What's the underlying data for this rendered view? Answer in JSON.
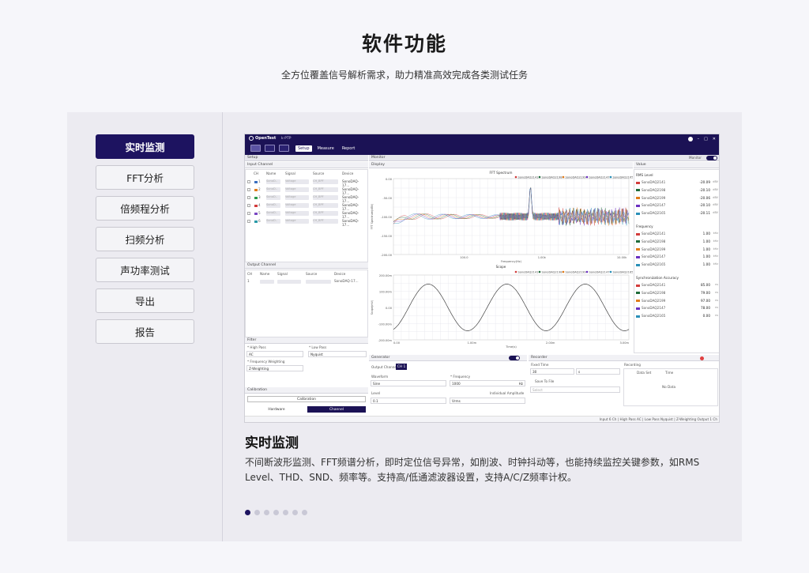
{
  "header": {
    "title": "软件功能",
    "subtitle": "全方位覆盖信号解析需求，助力精准高效完成各类测试任务"
  },
  "menu": {
    "items": [
      {
        "label": "实时监测",
        "active": true
      },
      {
        "label": "FFT分析",
        "active": false
      },
      {
        "label": "倍频程分析",
        "active": false
      },
      {
        "label": "扫频分析",
        "active": false
      },
      {
        "label": "声功率测试",
        "active": false
      },
      {
        "label": "导出",
        "active": false
      },
      {
        "label": "报告",
        "active": false
      }
    ]
  },
  "app": {
    "logo": "OpenTest",
    "project": "k-PTP",
    "tabs": [
      "Setup",
      "Measure",
      "Report"
    ],
    "setup_title": "Setup",
    "monitor_title": "Monitor",
    "monitor_label": "Monitor",
    "display_title": "Display",
    "value_title": "Value",
    "input_channel": {
      "title": "Input Channel",
      "columns": [
        "CH",
        "Name",
        "Signal",
        "Source",
        "Device"
      ],
      "rows": [
        {
          "ch": "1",
          "name": "SonoD..",
          "signal": "Voltage",
          "source": "CH_BPF",
          "device": "SonoDAQ-17..."
        },
        {
          "ch": "2",
          "name": "SonoD..",
          "signal": "Voltage",
          "source": "CH_BPF",
          "device": "SonoDAQ-17..."
        },
        {
          "ch": "3",
          "name": "SonoD..",
          "signal": "Voltage",
          "source": "CH_BPF",
          "device": "SonoDAQ-17..."
        },
        {
          "ch": "4",
          "name": "SonoD..",
          "signal": "Voltage",
          "source": "CH_BPF",
          "device": "SonoDAQ-17..."
        },
        {
          "ch": "5",
          "name": "SonoD..",
          "signal": "Voltage",
          "source": "CH_BPF",
          "device": "SonoDAQ-17..."
        },
        {
          "ch": "6",
          "name": "SonoD..",
          "signal": "Voltage",
          "source": "CH_BPF",
          "device": "SonoDAQ-17..."
        }
      ],
      "row_colors": [
        "#3a6fc0",
        "#e07b1a",
        "#2c9a4b",
        "#d23c3c",
        "#7a47c2",
        "#2a9aa8"
      ]
    },
    "output_channel": {
      "title": "Output Channel",
      "columns": [
        "CH",
        "Name",
        "Signal",
        "Source",
        "Device"
      ],
      "row": {
        "ch": "1",
        "device": "SonoDAQ-17..."
      }
    },
    "filter": {
      "title": "Filter",
      "high_pass_label": "* High Pass",
      "high_pass_value": "AC",
      "low_pass_label": "* Low Pass",
      "low_pass_value": "Nyquist",
      "weighting_label": "* Frequency Weighting",
      "weighting_value": "Z-Weighting"
    },
    "calibration": {
      "title": "Calibration",
      "button": "Calibration",
      "tabs": [
        "Hardware",
        "Channel"
      ]
    },
    "fft": {
      "title": "FFT Spectrum",
      "ylabel": "FFT Spectrum(dBV)",
      "xlabel": "Frequency(Hz)",
      "yticks": [
        "0.00",
        "-50.00",
        "-100.00",
        "-150.00",
        "-200.00"
      ],
      "xticks": [
        "100.0",
        "1.00k",
        "10.00k"
      ]
    },
    "scope": {
      "title": "Scope",
      "ylabel": "Scope(mV)",
      "xlabel": "Time(s)",
      "yticks": [
        "200.00m",
        "100.00m",
        "0.00",
        "-100.00m",
        "-200.00m"
      ],
      "xticks": [
        "0.00",
        "1.00m",
        "2.00m",
        "3.00m"
      ]
    },
    "legend": [
      "SonoDAQ2141",
      "SonoDAQ2198",
      "SonoDAQ2199",
      "SonoDAQ2147",
      "SonoDAQ2165"
    ],
    "legend_colors": [
      "#d23c3c",
      "#1e6b3a",
      "#e07b1a",
      "#6a2fc0",
      "#2a8fb8"
    ],
    "value_panel": {
      "rms_title": "RMS Level",
      "rms": [
        {
          "name": "SonoDAQ2141",
          "value": "-20.09",
          "unit": "dBV"
        },
        {
          "name": "SonoDAQ2198",
          "value": "-20.10",
          "unit": "dBV"
        },
        {
          "name": "SonoDAQ2199",
          "value": "-20.06",
          "unit": "dBV"
        },
        {
          "name": "SonoDAQ2147",
          "value": "-20.10",
          "unit": "dBV"
        },
        {
          "name": "SonoDAQ2165",
          "value": "-20.11",
          "unit": "dBV"
        }
      ],
      "freq_title": "Frequency",
      "freq": [
        {
          "name": "SonoDAQ2141",
          "value": "1.00",
          "unit": "kHz"
        },
        {
          "name": "SonoDAQ2198",
          "value": "1.00",
          "unit": "kHz"
        },
        {
          "name": "SonoDAQ2199",
          "value": "1.00",
          "unit": "kHz"
        },
        {
          "name": "SonoDAQ2147",
          "value": "1.00",
          "unit": "kHz"
        },
        {
          "name": "SonoDAQ2165",
          "value": "1.00",
          "unit": "kHz"
        }
      ],
      "sync_title": "Synchronization Accuracy",
      "sync": [
        {
          "name": "SonoDAQ2141",
          "value": "85.00",
          "unit": "ns"
        },
        {
          "name": "SonoDAQ2198",
          "value": "79.00",
          "unit": "ns"
        },
        {
          "name": "SonoDAQ2199",
          "value": "97.00",
          "unit": "ns"
        },
        {
          "name": "SonoDAQ2147",
          "value": "78.00",
          "unit": "ns"
        },
        {
          "name": "SonoDAQ2165",
          "value": "0.00",
          "unit": "ns"
        }
      ]
    },
    "generator": {
      "title": "Generator",
      "toggle": "ON",
      "output_channel_label": "Output Channel",
      "output_channel_value": "CH 1",
      "waveform_label": "Waveform",
      "waveform_value": "Sine",
      "frequency_label": "* Frequency",
      "frequency_value": "1000",
      "frequency_unit": "Hz",
      "level_label": "Level",
      "level_value": "0.1",
      "level_unit": "Vrms",
      "individual_label": "Individual Amplitude"
    },
    "recorder": {
      "title": "Recorder",
      "fixed_time_label": "Fixed Time",
      "fixed_time_value": "30",
      "fixed_time_unit": "s",
      "save_label": "Save To File",
      "select_placeholder": "Select",
      "recording_label": "Recording",
      "col_dataset": "Data Set",
      "col_time": "Time",
      "no_data": "No Data"
    },
    "status": "Input  6 Ch | High Pass  AC | Low Pass  Nyquist | Z-Weighting    Output  1 Ch"
  },
  "section": {
    "title": "实时监测",
    "description": "不间断波形监测、FFT频谱分析，即时定位信号异常，如削波、时钟抖动等，也能持续监控关键参数，如RMS Level、THD、SND、频率等。支持高/低通滤波器设置，支持A/C/Z频率计权。"
  },
  "pager": {
    "count": 7,
    "active": 0
  }
}
